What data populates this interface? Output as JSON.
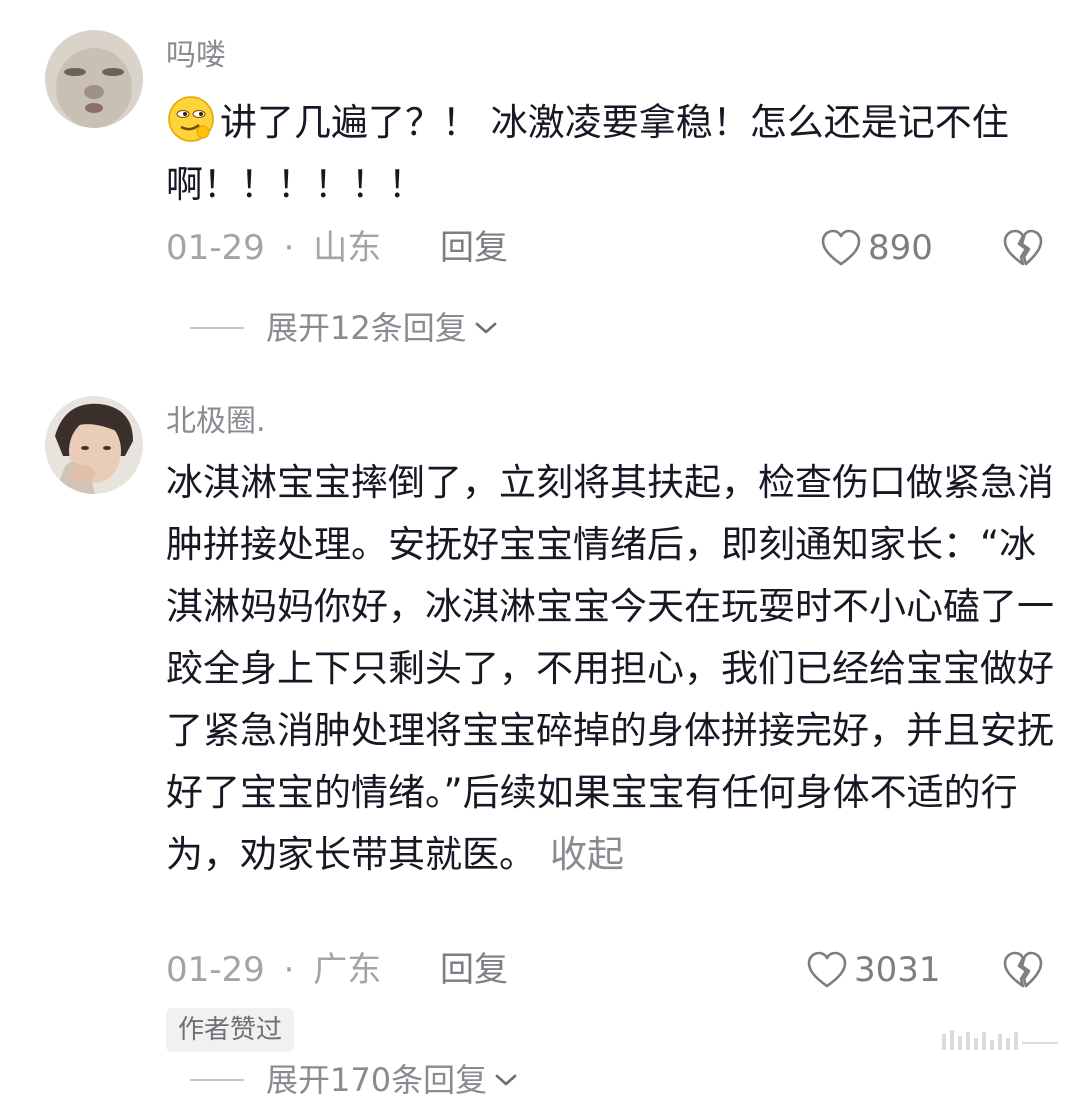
{
  "comments": [
    {
      "username": "吗喽",
      "emoji_icon": "smirk-face-emoji",
      "text": "讲了几遍了？！ 冰激凌要拿稳！怎么还是记不住啊！！！！！！",
      "date": "01-29",
      "separator": "·",
      "location": "山东",
      "reply_label": "回复",
      "likes": "890",
      "expand_label": "展开12条回复"
    },
    {
      "username": "北极圈.",
      "text": "冰淇淋宝宝摔倒了，立刻将其扶起，检查伤口做紧急消肿拼接处理。安抚好宝宝情绪后，即刻通知家长：“冰淇淋妈妈你好，冰淇淋宝宝今天在玩耍时不小心磕了一跤全身上下只剩头了，不用担心，我们已经给宝宝做好了紧急消肿处理将宝宝碎掉的身体拼接完好，并且安抚好了宝宝的情绪。”后续如果宝宝有任何身体不适的行为，劝家长带其就医。",
      "collapse_label": "收起",
      "date": "01-29",
      "separator": "·",
      "location": "广东",
      "reply_label": "回复",
      "likes": "3031",
      "badge": "作者赞过",
      "expand_label": "展开170条回复"
    }
  ],
  "colors": {
    "text_primary": "#161823",
    "text_secondary": "#8a8b91",
    "background": "#ffffff"
  }
}
